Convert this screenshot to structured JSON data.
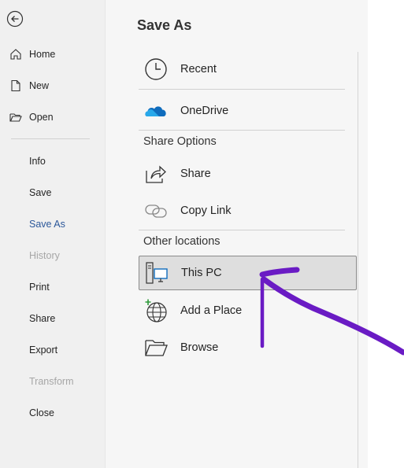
{
  "nav": {
    "back_label": "Back",
    "items": [
      {
        "label": "Home",
        "icon": "home-icon",
        "state": "normal"
      },
      {
        "label": "New",
        "icon": "new-document-icon",
        "state": "normal"
      },
      {
        "label": "Open",
        "icon": "folder-open-icon",
        "state": "normal"
      },
      {
        "label": "Info",
        "state": "normal"
      },
      {
        "label": "Save",
        "state": "normal"
      },
      {
        "label": "Save As",
        "state": "active"
      },
      {
        "label": "History",
        "state": "disabled"
      },
      {
        "label": "Print",
        "state": "normal"
      },
      {
        "label": "Share",
        "state": "normal"
      },
      {
        "label": "Export",
        "state": "normal"
      },
      {
        "label": "Transform",
        "state": "disabled"
      },
      {
        "label": "Close",
        "state": "normal"
      }
    ]
  },
  "main": {
    "title": "Save As",
    "locations_top": [
      {
        "label": "Recent",
        "icon": "clock-icon"
      },
      {
        "label": "OneDrive",
        "icon": "onedrive-cloud-icon"
      }
    ],
    "share_section": {
      "heading": "Share Options",
      "items": [
        {
          "label": "Share",
          "icon": "share-icon"
        },
        {
          "label": "Copy Link",
          "icon": "link-icon"
        }
      ]
    },
    "other_section": {
      "heading": "Other locations",
      "items": [
        {
          "label": "This PC",
          "icon": "computer-icon",
          "selected": true
        },
        {
          "label": "Add a Place",
          "icon": "globe-add-icon",
          "selected": false
        },
        {
          "label": "Browse",
          "icon": "folder-browse-icon",
          "selected": false
        }
      ]
    }
  },
  "colors": {
    "nav_bg": "#f0f0f0",
    "main_bg": "#f6f6f6",
    "active_text": "#2b579a",
    "disabled_text": "#a6a6a6",
    "annotation": "#6a1bc4",
    "onedrive": "#0f6cbd"
  }
}
